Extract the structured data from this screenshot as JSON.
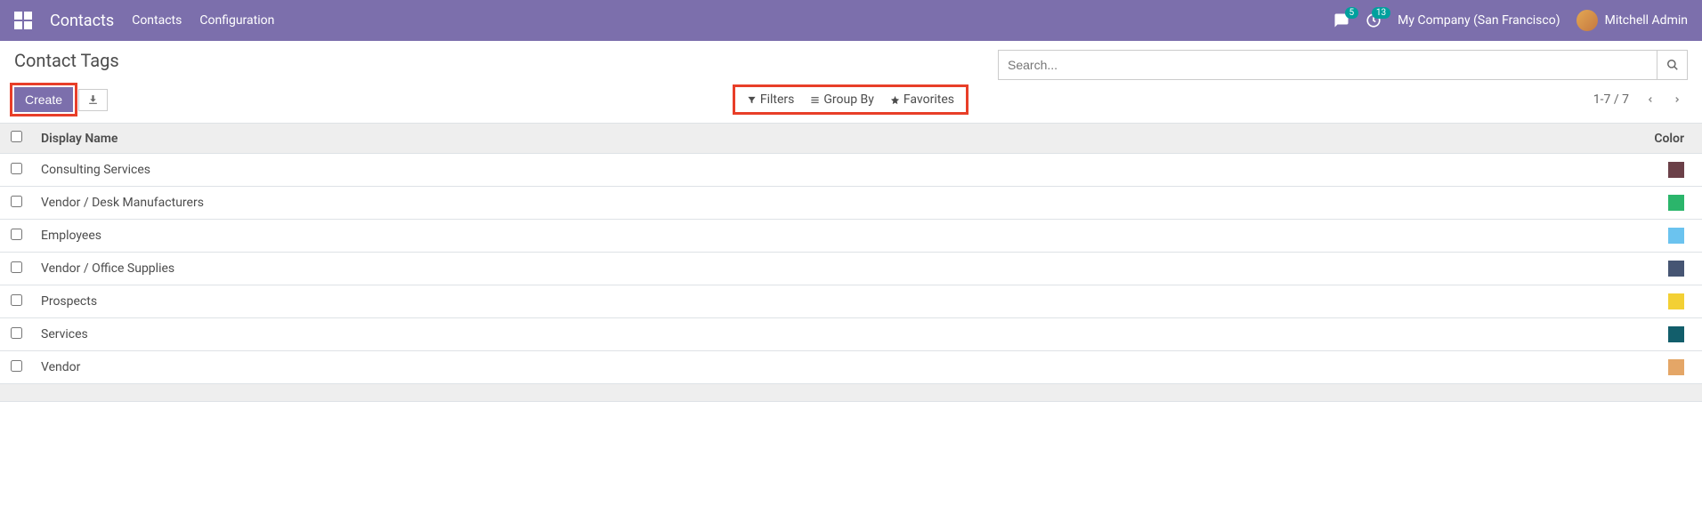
{
  "navbar": {
    "app_title": "Contacts",
    "links": [
      "Contacts",
      "Configuration"
    ],
    "messages_badge": "5",
    "activities_badge": "13",
    "company": "My Company (San Francisco)",
    "user": "Mitchell Admin"
  },
  "control_panel": {
    "title": "Contact Tags",
    "search_placeholder": "Search...",
    "create_label": "Create",
    "filters_label": "Filters",
    "groupby_label": "Group By",
    "favorites_label": "Favorites",
    "pager": "1-7 / 7"
  },
  "table": {
    "header_name": "Display Name",
    "header_color": "Color",
    "rows": [
      {
        "name": "Consulting Services",
        "color": "#6b4048"
      },
      {
        "name": "Vendor / Desk Manufacturers",
        "color": "#2bb56b"
      },
      {
        "name": "Employees",
        "color": "#6bc3ef"
      },
      {
        "name": "Vendor / Office Supplies",
        "color": "#465573"
      },
      {
        "name": "Prospects",
        "color": "#f3d034"
      },
      {
        "name": "Services",
        "color": "#125e6b"
      },
      {
        "name": "Vendor",
        "color": "#e4a667"
      }
    ]
  }
}
